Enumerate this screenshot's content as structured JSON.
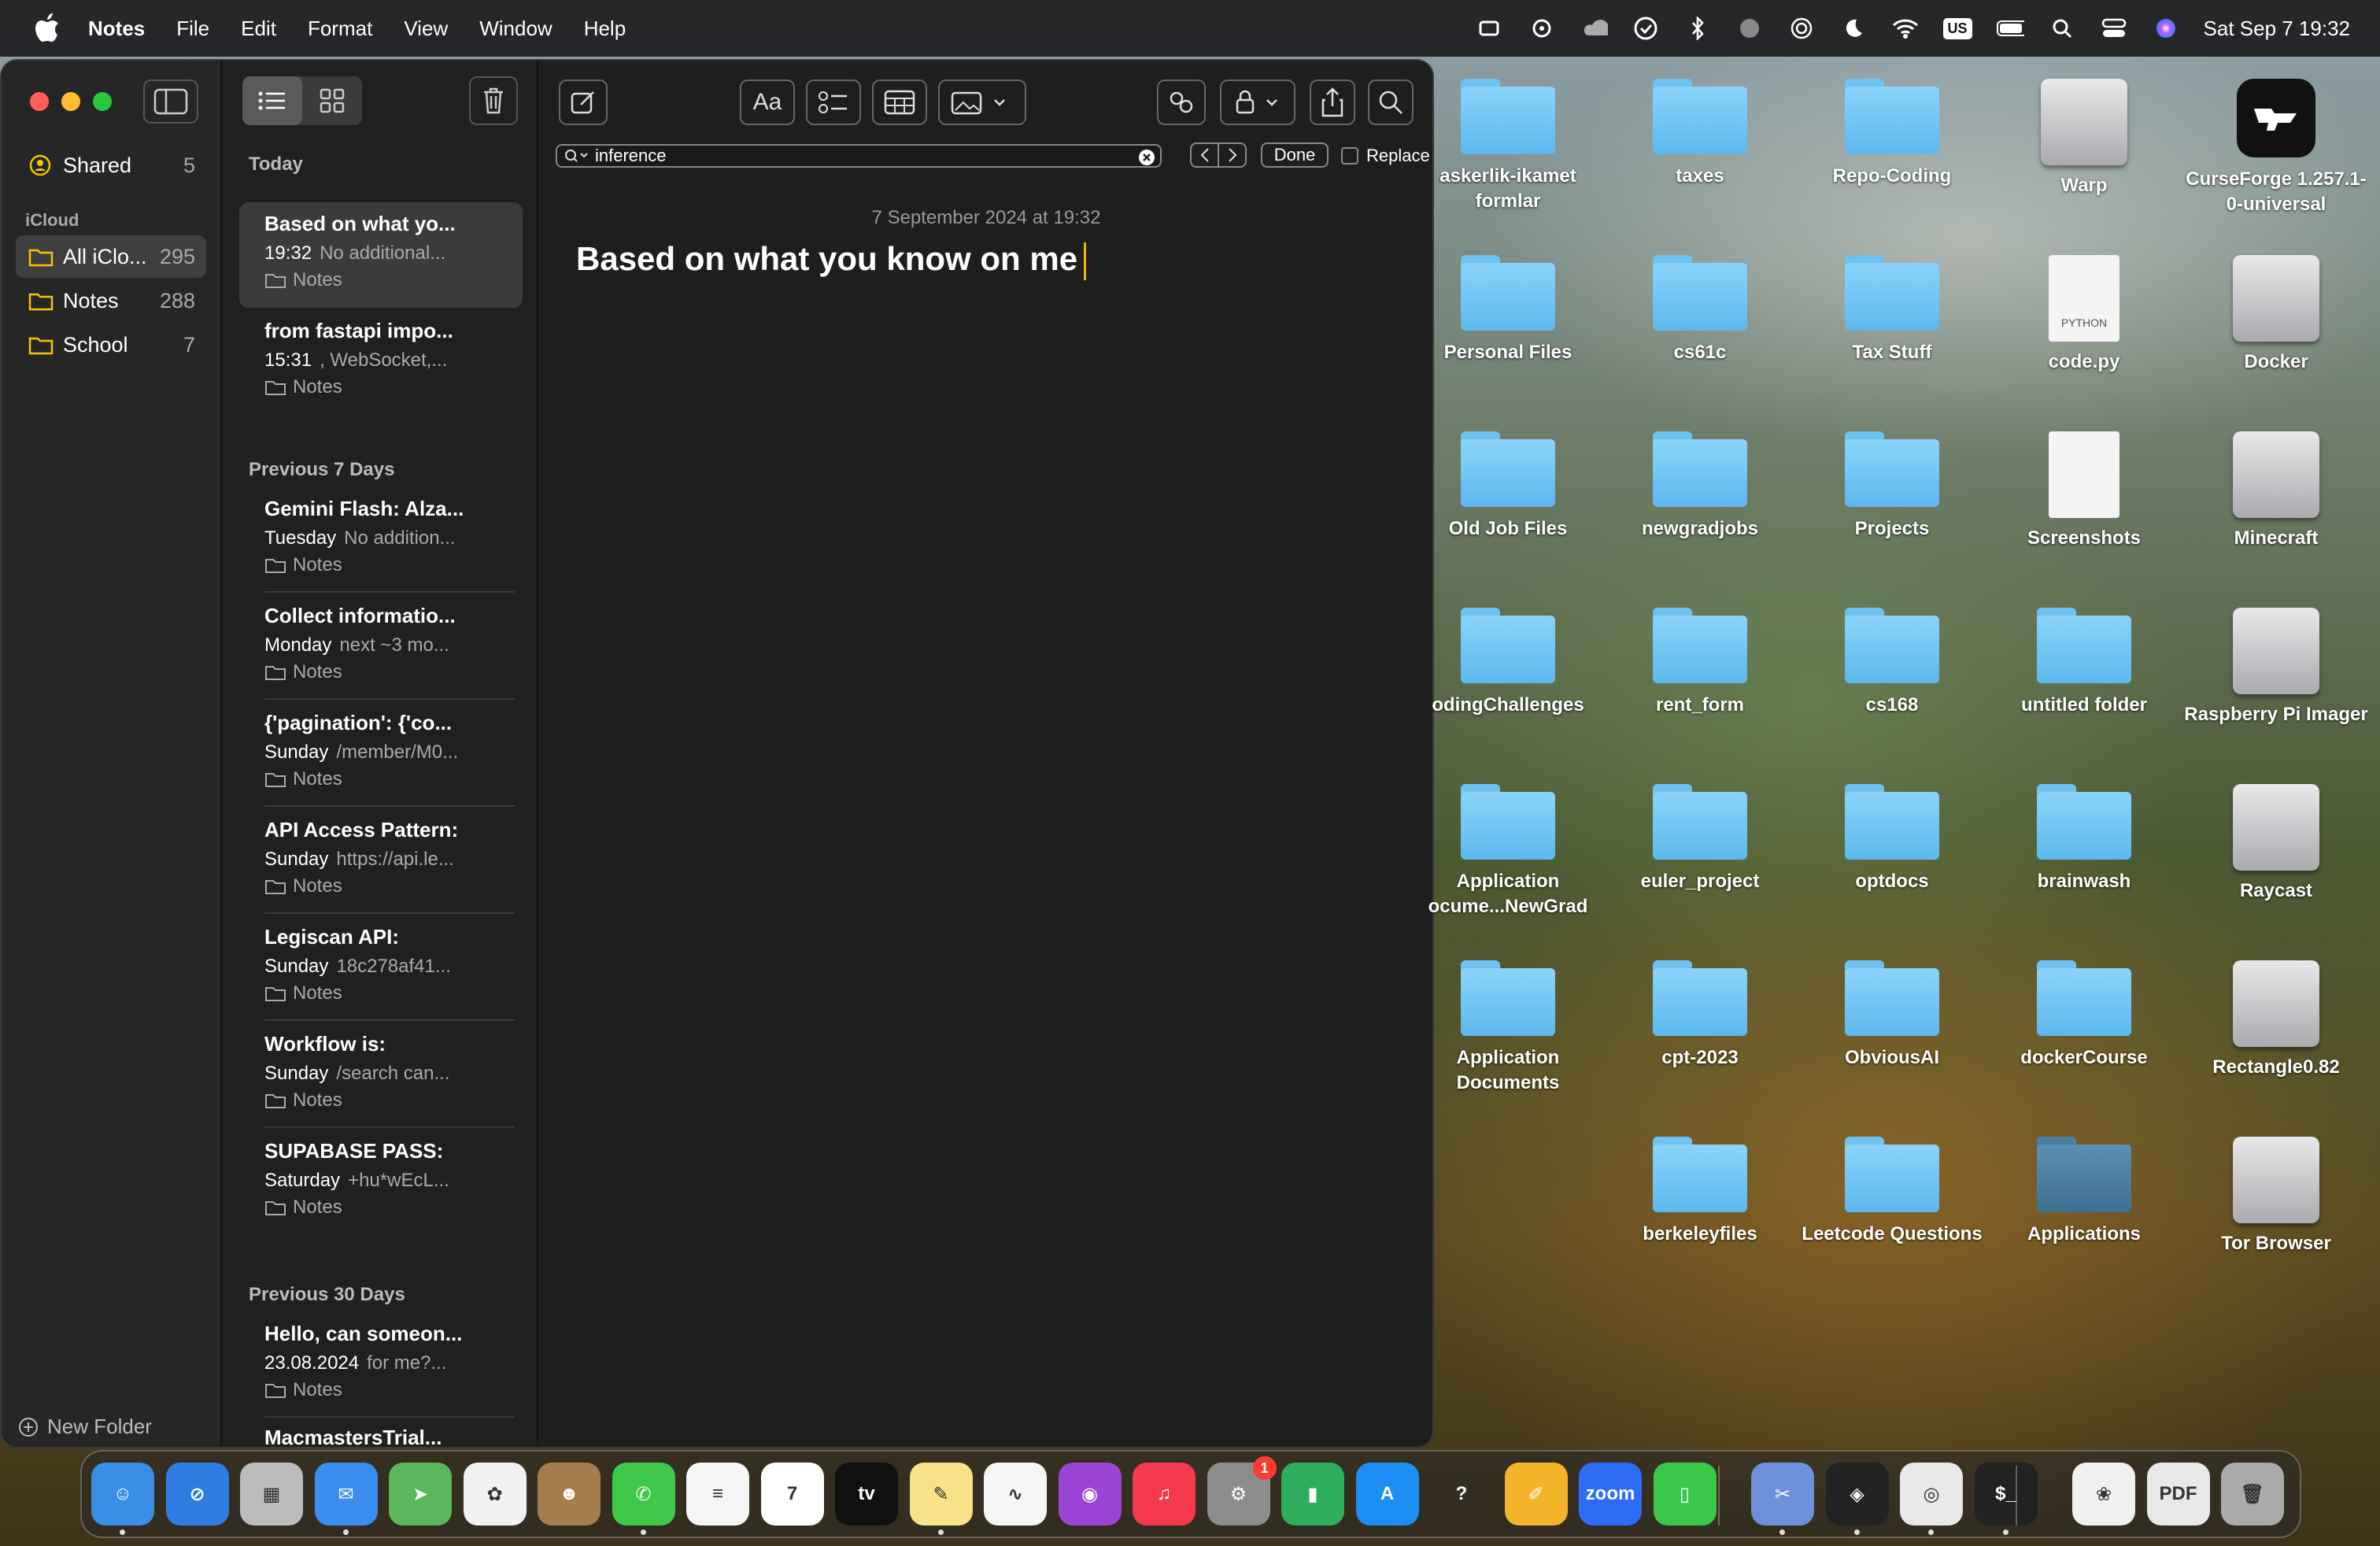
{
  "menubar": {
    "app": "Notes",
    "menus": [
      "File",
      "Edit",
      "Format",
      "View",
      "Window",
      "Help"
    ],
    "keyboard": "US",
    "clock": "Sat Sep 7  19:32",
    "status_icons": [
      "stage-manager-icon",
      "cleanshot-icon",
      "cloud-icon",
      "screen-time-icon",
      "bluetooth-icon",
      "network-icon",
      "airdrop-icon",
      "focus-moon-icon",
      "wifi-icon",
      "keyboard-input-icon",
      "battery-icon",
      "spotlight-icon",
      "control-center-icon",
      "siri-icon"
    ]
  },
  "sidebar": {
    "shared_label": "Shared",
    "shared_count": "5",
    "section": "iCloud",
    "folders": [
      {
        "label": "All iClo...",
        "count": "295"
      },
      {
        "label": "Notes",
        "count": "288"
      },
      {
        "label": "School",
        "count": "7"
      }
    ],
    "new_folder": "New Folder"
  },
  "notes_list": {
    "groups": [
      "Today",
      "Previous 7 Days",
      "Previous 30 Days"
    ],
    "notes": [
      {
        "title": "Based on what yo...",
        "time": "19:32",
        "preview": "No additional...",
        "folder": "Notes"
      },
      {
        "title": "from fastapi impo...",
        "time": "15:31",
        "preview": ", WebSocket,...",
        "folder": "Notes"
      },
      {
        "title": "Gemini Flash: Alza...",
        "time": "Tuesday",
        "preview": "No addition...",
        "folder": "Notes"
      },
      {
        "title": "Collect informatio...",
        "time": "Monday",
        "preview": "next ~3 mo...",
        "folder": "Notes"
      },
      {
        "title": "{'pagination': {'co...",
        "time": "Sunday",
        "preview": "/member/M0...",
        "folder": "Notes"
      },
      {
        "title": "API Access Pattern:",
        "time": "Sunday",
        "preview": "https://api.le...",
        "folder": "Notes"
      },
      {
        "title": "Legiscan API:",
        "time": "Sunday",
        "preview": "18c278af41...",
        "folder": "Notes"
      },
      {
        "title": "Workflow is:",
        "time": "Sunday",
        "preview": "/search can...",
        "folder": "Notes"
      },
      {
        "title": "SUPABASE PASS:",
        "time": "Saturday",
        "preview": "+hu*wEcL...",
        "folder": "Notes"
      },
      {
        "title": "Hello, can someon...",
        "time": "23.08.2024",
        "preview": "for me?...",
        "folder": "Notes"
      },
      {
        "title": "MacmastersTrial...",
        "time": "",
        "preview": "",
        "folder": ""
      }
    ]
  },
  "editor": {
    "format_label": "Aa",
    "search_value": "inference",
    "done_label": "Done",
    "replace_label": "Replace",
    "date": "7 September 2024 at 19:32",
    "note_title": "Based on what you know on me"
  },
  "desktop": [
    {
      "label": "askerlik-ikamet formlar",
      "kind": "folder"
    },
    {
      "label": "taxes",
      "kind": "folder"
    },
    {
      "label": "Repo-Coding",
      "kind": "folder"
    },
    {
      "label": "Warp",
      "kind": "disk"
    },
    {
      "label": "CurseForge 1.257.1-0-universal",
      "kind": "app"
    },
    {
      "label": "Personal Files",
      "kind": "folder"
    },
    {
      "label": "cs61c",
      "kind": "folder"
    },
    {
      "label": "Tax Stuff",
      "kind": "folder"
    },
    {
      "label": "code.py",
      "kind": "doc",
      "doc_label": "PYTHON"
    },
    {
      "label": "Docker",
      "kind": "disk"
    },
    {
      "label": "Old Job Files",
      "kind": "folder"
    },
    {
      "label": "newgradjobs",
      "kind": "folder"
    },
    {
      "label": "Projects",
      "kind": "folder"
    },
    {
      "label": "Screenshots",
      "kind": "blank"
    },
    {
      "label": "Minecraft",
      "kind": "disk"
    },
    {
      "label": "odingChallenges",
      "kind": "folder"
    },
    {
      "label": "rent_form",
      "kind": "folder"
    },
    {
      "label": "cs168",
      "kind": "folder"
    },
    {
      "label": "untitled folder",
      "kind": "folder"
    },
    {
      "label": "Raspberry Pi Imager",
      "kind": "disk"
    },
    {
      "label": "Application ocume...NewGrad",
      "kind": "folder"
    },
    {
      "label": "euler_project",
      "kind": "folder"
    },
    {
      "label": "optdocs",
      "kind": "folder"
    },
    {
      "label": "brainwash",
      "kind": "folder"
    },
    {
      "label": "Raycast",
      "kind": "disk"
    },
    {
      "label": "Application Documents",
      "kind": "folder"
    },
    {
      "label": "cpt-2023",
      "kind": "folder"
    },
    {
      "label": "ObviousAI",
      "kind": "folder"
    },
    {
      "label": "dockerCourse",
      "kind": "folder"
    },
    {
      "label": "Rectangle0.82",
      "kind": "disk"
    },
    {
      "label": "",
      "kind": "none"
    },
    {
      "label": "berkeleyfiles",
      "kind": "folder"
    },
    {
      "label": "Leetcode Questions",
      "kind": "folder"
    },
    {
      "label": "Applications",
      "kind": "folder-dark"
    },
    {
      "label": "Tor Browser",
      "kind": "disk"
    }
  ],
  "dock": {
    "apps": [
      {
        "name": "finder-icon",
        "color": "#3a8ee6",
        "glyph": "☺",
        "running": true
      },
      {
        "name": "safari-icon",
        "color": "#2f7de1",
        "glyph": "⊘",
        "running": false
      },
      {
        "name": "launchpad-icon",
        "color": "#bbb",
        "glyph": "▦",
        "running": false
      },
      {
        "name": "mail-icon",
        "color": "#3b8df0",
        "glyph": "✉",
        "running": true
      },
      {
        "name": "maps-icon",
        "color": "#5bb75b",
        "glyph": "➤",
        "running": false
      },
      {
        "name": "photos-icon",
        "color": "#f1f1f1",
        "glyph": "✿",
        "running": false
      },
      {
        "name": "contacts-icon",
        "color": "#a57d4c",
        "glyph": "☻",
        "running": false
      },
      {
        "name": "messages-icon",
        "color": "#3fc84a",
        "glyph": "✆",
        "running": true
      },
      {
        "name": "reminders-icon",
        "color": "#f5f5f5",
        "glyph": "≡",
        "running": false
      },
      {
        "name": "calendar-icon",
        "color": "#ffffff",
        "glyph": "7",
        "running": false
      },
      {
        "name": "appletv-icon",
        "color": "#111",
        "glyph": "tv",
        "running": false
      },
      {
        "name": "notes-icon",
        "color": "#f7e28a",
        "glyph": "✎",
        "running": true
      },
      {
        "name": "freeform-icon",
        "color": "#f6f6f6",
        "glyph": "∿",
        "running": false
      },
      {
        "name": "podcasts-icon",
        "color": "#9b45d6",
        "glyph": "◉",
        "running": false
      },
      {
        "name": "music-icon",
        "color": "#f5394c",
        "glyph": "♫",
        "running": false
      },
      {
        "name": "system-settings-icon",
        "color": "#8c8c8c",
        "glyph": "⚙",
        "running": false,
        "badge": "1"
      },
      {
        "name": "numbers-icon",
        "color": "#2eae5c",
        "glyph": "▮",
        "running": false
      },
      {
        "name": "appstore-icon",
        "color": "#1d8ef3",
        "glyph": "A",
        "running": false
      },
      {
        "name": "help-icon",
        "color": "transparent",
        "glyph": "?",
        "running": false
      },
      {
        "name": "pages-icon",
        "color": "#f4b429",
        "glyph": "✐",
        "running": false
      },
      {
        "name": "zoom-icon",
        "color": "#2d6cf6",
        "glyph": "zoom",
        "running": false
      },
      {
        "name": "android-studio-icon",
        "color": "#3ac84a",
        "glyph": "▯",
        "running": false
      },
      {
        "name": "preview-icon",
        "color": "#6e8fd9",
        "glyph": "✂",
        "running": true
      },
      {
        "name": "unity-icon",
        "color": "#222",
        "glyph": "◈",
        "running": true
      },
      {
        "name": "chrome-icon",
        "color": "#e8e8e8",
        "glyph": "◎",
        "running": true
      },
      {
        "name": "terminal-icon",
        "color": "#222",
        "glyph": "$_",
        "running": true
      },
      {
        "name": "ollama-icon",
        "color": "#f0f0f0",
        "glyph": "❀",
        "running": false
      },
      {
        "name": "pdf-icon",
        "color": "#e8e8e8",
        "glyph": "PDF",
        "running": false
      },
      {
        "name": "trash-icon",
        "color": "#aaa",
        "glyph": "🗑",
        "running": false
      }
    ]
  }
}
